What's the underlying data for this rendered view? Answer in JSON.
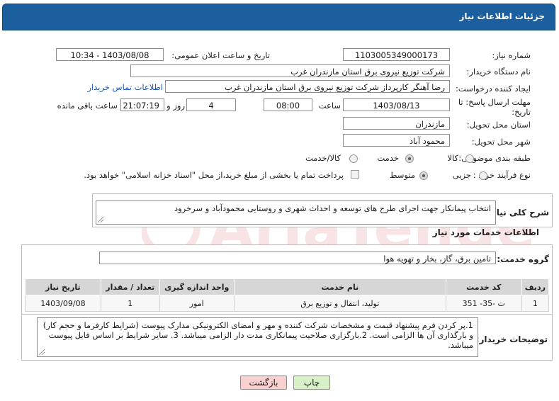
{
  "header": {
    "title": "جزئیات اطلاعات نیاز"
  },
  "fields": {
    "need_number_label": "شماره نیاز:",
    "need_number": "1103005349000173",
    "announce_label": "تاریخ و ساعت اعلان عمومی:",
    "announce_value": "1403/08/08 - 10:34",
    "buyer_org_label": "نام دستگاه خریدار:",
    "buyer_org": "شرکت توزیع نیروی برق استان مازندران غرب",
    "requester_label": "ایجاد کننده درخواست:",
    "requester": "رضا آهنگر کارپرداز شرکت توزیع نیروی برق استان مازندران غرب",
    "contact_link": "اطلاعات تماس خریدار",
    "deadline_label_1": "مهلت ارسال پاسخ: تا",
    "deadline_label_2": "تاریخ:",
    "deadline_date": "1403/08/13",
    "hour_label": "ساعت",
    "deadline_time": "08:00",
    "days_value": "4",
    "days_label": "روز و",
    "remaining_time": "21:07:19",
    "remaining_label": "ساعت باقی مانده",
    "province_label": "استان محل تحویل:",
    "province": "مازندران",
    "city_label": "شهر محل تحویل:",
    "city": "محمود آباد",
    "category_label": "طبقه بندی موضوعی:",
    "category_options": [
      "کالا",
      "خدمت",
      "کالا/خدمت"
    ],
    "category_selected": "خدمت",
    "purchase_type_label": "نوع فرآیند خرید :",
    "purchase_options": [
      "جزیی",
      "متوسط"
    ],
    "purchase_selected": "متوسط",
    "payment_note": "پرداخت تمام یا بخشی از مبلغ خرید،از محل \"اسناد خزانه اسلامی\" خواهد بود."
  },
  "summary": {
    "label": "شرح کلی نیاز:",
    "text": "انتخاب پیمانکار جهت  اجرای طرح های توسعه و احداث شهری و روستایی محمودآباد و سرخرود"
  },
  "services": {
    "section_title": "اطلاعات خدمات مورد نیاز",
    "group_label": "گروه خدمت:",
    "group_value": "تامین برق، گاز، بخار و تهویه هوا",
    "columns": [
      "ردیف",
      "کد خدمت",
      "نام خدمت",
      "واحد اندازه گیری",
      "تعداد / مقدار",
      "تاریخ نیاز"
    ],
    "rows": [
      [
        "1",
        "ت -35- 351",
        "تولید، انتقال و توزیع برق",
        "امور",
        "1",
        "1403/09/08"
      ]
    ]
  },
  "buyer_notes": {
    "label": "توضیحات خریدار:",
    "text": "1.پر کردن فرم پیشنهاد قیمت و مشخصات شرکت کننده و مهر و امضای الکترونیکی مدارک پیوست (شرایط کارفرما و حجم کار) و بارگذاری آن ها الزامی است. 2.بارگزاری صلاحیت پیمانکاری مدت دار الزامی میباشد. 3. سایر شرایط بر اساس فایل پیوست میباشد."
  },
  "buttons": {
    "print": "چاپ",
    "back": "بازگشت"
  },
  "watermark": {
    "text": "AriaTender.neT"
  },
  "colors": {
    "header_bg": "#1b5f9e",
    "print_bg": "#d8f0c8",
    "back_bg": "#f8d0d0"
  }
}
